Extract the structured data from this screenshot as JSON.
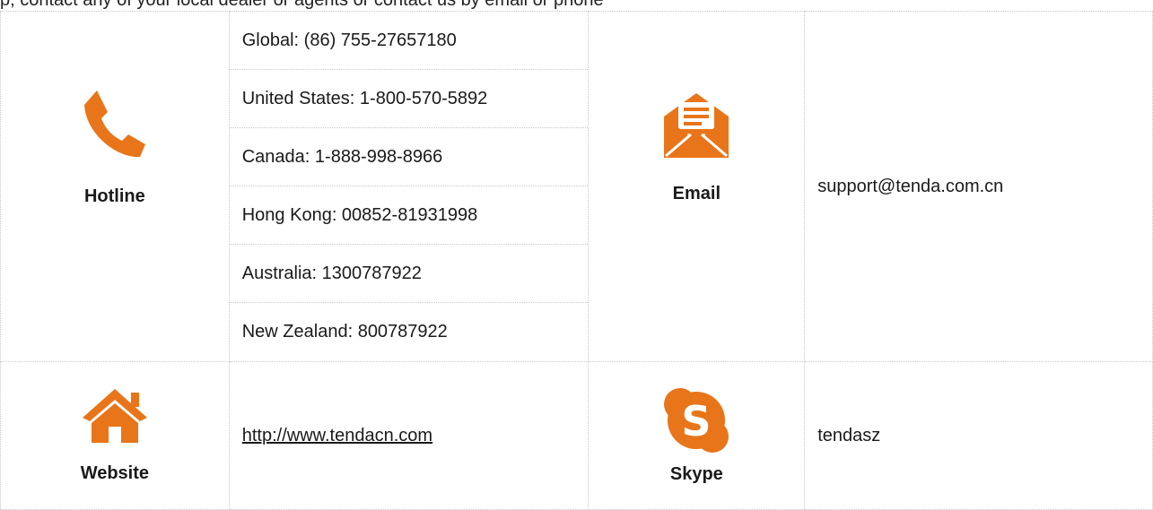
{
  "top_text": "p, contact any of your local dealer or agents or contact us by email or phone",
  "hotline": {
    "label": "Hotline",
    "numbers": [
      "Global: (86) 755-27657180",
      "United States: 1-800-570-5892",
      "Canada: 1-888-998-8966",
      "Hong Kong: 00852-81931998",
      "Australia: 1300787922",
      "New Zealand: 800787922"
    ]
  },
  "email": {
    "label": "Email",
    "address": "support@tenda.com.cn"
  },
  "website": {
    "label": "Website",
    "url": "http://www.tendacn.com"
  },
  "skype": {
    "label": "Skype",
    "id": "tendasz"
  },
  "colors": {
    "icon_orange": "#E8751A"
  },
  "icons": [
    "phone-icon",
    "envelope-icon",
    "home-icon",
    "skype-icon"
  ]
}
